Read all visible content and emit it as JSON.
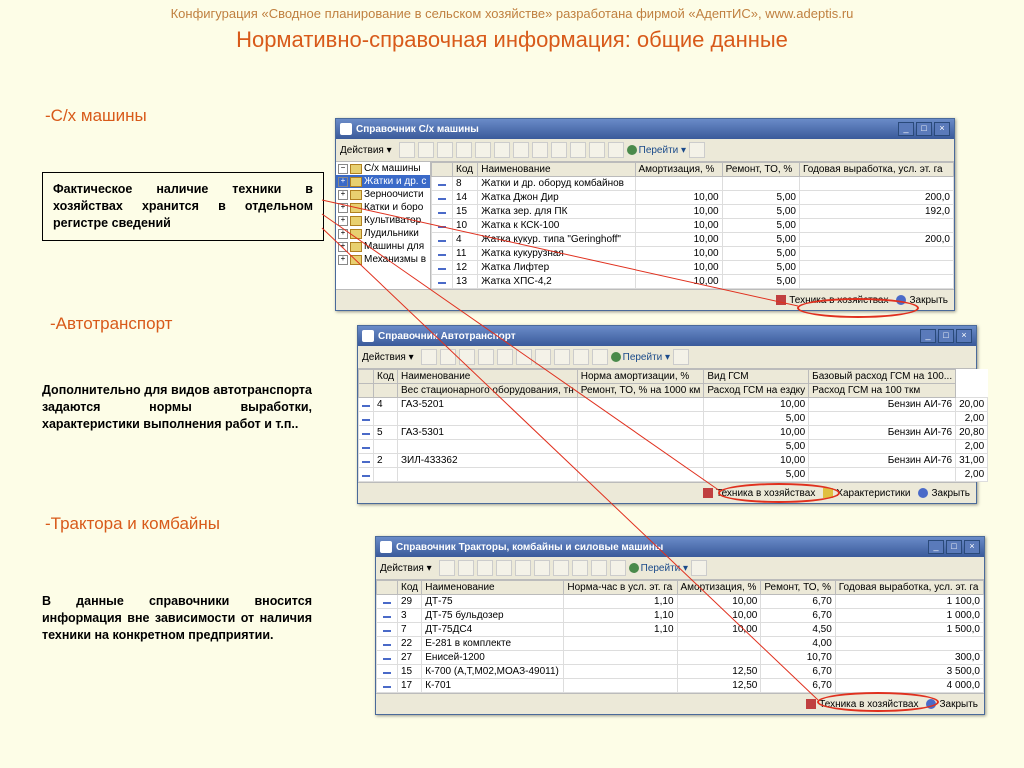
{
  "header": "Конфигурация «Сводное планирование в сельском хозяйстве» разработана фирмой «АдептИС», www.adeptis.ru",
  "title": "Нормативно-справочная информация: общие данные",
  "sections": {
    "s1": "-С/х машины",
    "s2": "-Автотранспорт",
    "s3": "-Трактора и комбайны"
  },
  "box1": "Фактическое наличие техники в хозяйствах хранится в отдельном регистре сведений",
  "desc2": "Дополнительно для видов автотранспорта задаются нормы выработки, характеристики выполнения работ и т.п..",
  "desc3": "В данные справочники вносится информация вне зависимости от наличия техники на конкретном предприятии.",
  "toolbar": {
    "actions": "Действия ▾",
    "goto": "Перейти ▾"
  },
  "status": {
    "tech": "Техника в хозяйствах",
    "char": "Характеристики",
    "close": "Закрыть"
  },
  "win1": {
    "title": "Справочник С/х машины",
    "tree": [
      "С/х машины",
      "Жатки и др. с",
      "Зерноочисти",
      "Катки и боро",
      "Культиватор",
      "Лудильники",
      "Машины для",
      "Механизмы в"
    ],
    "headers": [
      "",
      "Код",
      "Наименование",
      "Амортизация, %",
      "Ремонт, ТО, %",
      "Годовая выработка, усл. эт. га"
    ],
    "rows": [
      [
        "8",
        "Жатки и др. оборуд комбайнов",
        "",
        "",
        ""
      ],
      [
        "14",
        "Жатка Джон Дир",
        "10,00",
        "5,00",
        "200,0"
      ],
      [
        "15",
        "Жатка зер. для ПК",
        "10,00",
        "5,00",
        "192,0"
      ],
      [
        "10",
        "Жатка к КСК-100",
        "10,00",
        "5,00",
        ""
      ],
      [
        "4",
        "Жатка кукур. типа \"Geringhoff\"",
        "10,00",
        "5,00",
        "200,0"
      ],
      [
        "11",
        "Жатка кукурузная",
        "10,00",
        "5,00",
        ""
      ],
      [
        "12",
        "Жатка Лифтер",
        "10,00",
        "5,00",
        ""
      ],
      [
        "13",
        "Жатка ХПС-4,2",
        "10,00",
        "5,00",
        ""
      ]
    ]
  },
  "win2": {
    "title": "Справочник Автотранспорт",
    "headers1": [
      "",
      "Код",
      "Наименование",
      "Норма амортизации, %",
      "Вид ГСМ",
      "Базовый расход ГСМ на 100..."
    ],
    "headers2": [
      "",
      "",
      "Вес стационарного оборудования, тн",
      "Ремонт, ТО, % на 1000 км",
      "Расход ГСМ на ездку",
      "Расход ГСМ на 100 ткм"
    ],
    "rows": [
      [
        "4",
        "ГАЗ-5201",
        "",
        "10,00",
        "Бензин АИ-76",
        "20,00"
      ],
      [
        "",
        "",
        "",
        "5,00",
        "",
        "2,00"
      ],
      [
        "5",
        "ГАЗ-5301",
        "",
        "10,00",
        "Бензин АИ-76",
        "20,80"
      ],
      [
        "",
        "",
        "",
        "5,00",
        "",
        "2,00"
      ],
      [
        "2",
        "ЗИЛ-433362",
        "",
        "10,00",
        "Бензин АИ-76",
        "31,00"
      ],
      [
        "",
        "",
        "",
        "5,00",
        "",
        "2,00"
      ]
    ]
  },
  "win3": {
    "title": "Справочник Тракторы, комбайны и силовые машины",
    "headers": [
      "",
      "Код",
      "Наименование",
      "Норма-час в усл. эт. га",
      "Амортизация, %",
      "Ремонт, ТО, %",
      "Годовая выработка, усл. эт. га"
    ],
    "rows": [
      [
        "29",
        "ДТ-75",
        "1,10",
        "10,00",
        "6,70",
        "1 100,0"
      ],
      [
        "3",
        "ДТ-75 бульдозер",
        "1,10",
        "10,00",
        "6,70",
        "1 000,0"
      ],
      [
        "7",
        "ДТ-75ДС4",
        "1,10",
        "10,00",
        "4,50",
        "1 500,0"
      ],
      [
        "22",
        "Е-281 в комплекте",
        "",
        "",
        "4,00",
        ""
      ],
      [
        "27",
        "Енисей-1200",
        "",
        "",
        "10,70",
        "300,0"
      ],
      [
        "15",
        "К-700 (А,Т,М02,МОАЗ-49011)",
        "",
        "12,50",
        "6,70",
        "3 500,0"
      ],
      [
        "17",
        "К-701",
        "",
        "12,50",
        "6,70",
        "4 000,0"
      ]
    ]
  }
}
